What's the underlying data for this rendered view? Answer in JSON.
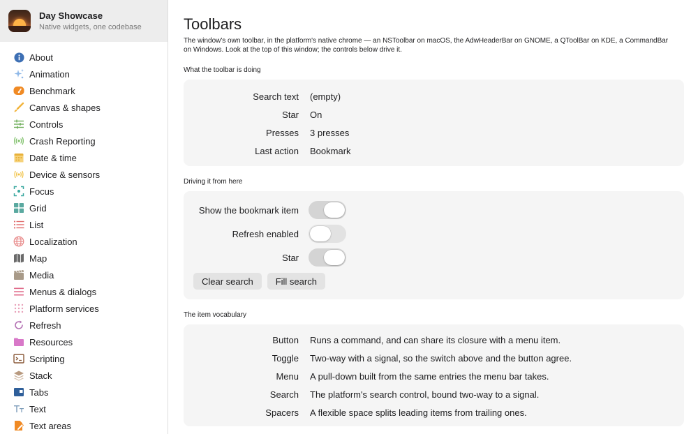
{
  "app": {
    "title": "Day Showcase",
    "subtitle": "Native widgets, one codebase",
    "icon": "sunset-app-icon"
  },
  "sidebar": {
    "items": [
      {
        "label": "About",
        "icon": "info-icon",
        "color": "#3d6fb4"
      },
      {
        "label": "Animation",
        "icon": "sparkle-icon",
        "color": "#8fb8e8"
      },
      {
        "label": "Benchmark",
        "icon": "gauge-icon",
        "color": "#f08a24"
      },
      {
        "label": "Canvas & shapes",
        "icon": "brush-icon",
        "color": "#f2b33a"
      },
      {
        "label": "Controls",
        "icon": "sliders-icon",
        "color": "#6fae5a"
      },
      {
        "label": "Crash Reporting",
        "icon": "broadcast-icon",
        "color": "#7fc06a"
      },
      {
        "label": "Date & time",
        "icon": "calendar-icon",
        "color": "#e8b13a"
      },
      {
        "label": "Device & sensors",
        "icon": "sensor-icon",
        "color": "#f0c040"
      },
      {
        "label": "Focus",
        "icon": "focus-icon",
        "color": "#3aa8a0"
      },
      {
        "label": "Grid",
        "icon": "grid-icon",
        "color": "#5aa9a0"
      },
      {
        "label": "List",
        "icon": "list-icon",
        "color": "#e06b6b"
      },
      {
        "label": "Localization",
        "icon": "globe-icon",
        "color": "#e88a8a"
      },
      {
        "label": "Map",
        "icon": "map-icon",
        "color": "#6b6b6b"
      },
      {
        "label": "Media",
        "icon": "film-icon",
        "color": "#a89a88"
      },
      {
        "label": "Menus & dialogs",
        "icon": "menu-icon",
        "color": "#e06b8a"
      },
      {
        "label": "Platform services",
        "icon": "dots-grid-icon",
        "color": "#e8a0b8"
      },
      {
        "label": "Refresh",
        "icon": "refresh-icon",
        "color": "#b06bb0"
      },
      {
        "label": "Resources",
        "icon": "folder-icon",
        "color": "#d878c8"
      },
      {
        "label": "Scripting",
        "icon": "terminal-icon",
        "color": "#8a5a3a"
      },
      {
        "label": "Stack",
        "icon": "stack-icon",
        "color": "#b89a80"
      },
      {
        "label": "Tabs",
        "icon": "tabs-icon",
        "color": "#2f5f9a"
      },
      {
        "label": "Text",
        "icon": "text-icon",
        "color": "#7a9ab8"
      },
      {
        "label": "Text areas",
        "icon": "document-edit-icon",
        "color": "#f08a24"
      }
    ]
  },
  "main": {
    "title": "Toolbars",
    "description": "The window's own toolbar, in the platform's native chrome — an NSToolbar on macOS, the AdwHeaderBar on GNOME, a QToolBar on KDE, a CommandBar on Windows. Look at the top of this window; the controls below drive it.",
    "status_section": {
      "title": "What the toolbar is doing",
      "rows": [
        {
          "key": "Search text",
          "value": "(empty)"
        },
        {
          "key": "Star",
          "value": "On"
        },
        {
          "key": "Presses",
          "value": "3 presses"
        },
        {
          "key": "Last action",
          "value": "Bookmark"
        }
      ]
    },
    "drive_section": {
      "title": "Driving it from here",
      "toggles": [
        {
          "label": "Show the bookmark item",
          "on": true
        },
        {
          "label": "Refresh enabled",
          "on": false
        },
        {
          "label": "Star",
          "on": true
        }
      ],
      "buttons": {
        "clear": "Clear search",
        "fill": "Fill search"
      }
    },
    "vocab_section": {
      "title": "The item vocabulary",
      "rows": [
        {
          "key": "Button",
          "value": "Runs a command, and can share its closure with a menu item."
        },
        {
          "key": "Toggle",
          "value": "Two-way with a signal, so the switch above and the button agree."
        },
        {
          "key": "Menu",
          "value": "A pull-down built from the same entries the menu bar takes."
        },
        {
          "key": "Search",
          "value": "The platform's search control, bound two-way to a signal."
        },
        {
          "key": "Spacers",
          "value": "A flexible space splits leading items from trailing ones."
        }
      ]
    }
  }
}
